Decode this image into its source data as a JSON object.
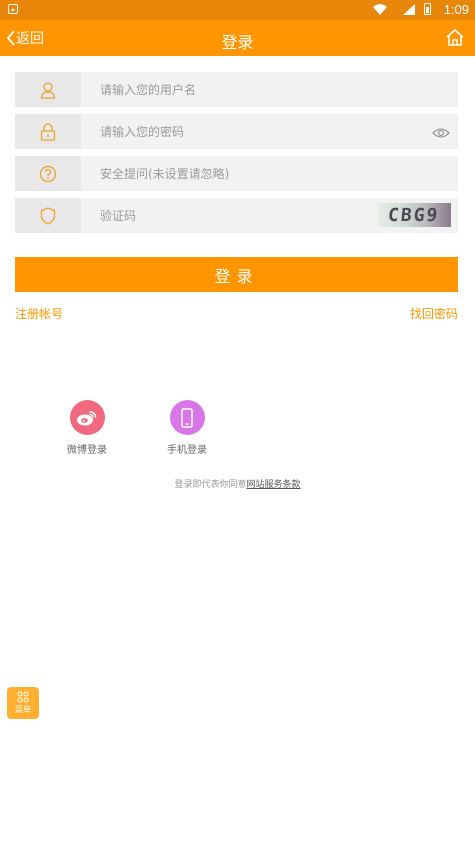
{
  "status_bar": {
    "time": "1:09"
  },
  "nav": {
    "back_label": "返回",
    "title": "登录"
  },
  "form": {
    "username_placeholder": "请输入您的用户名",
    "password_placeholder": "请输入您的密码",
    "security_question_placeholder": "安全提问(未设置请忽略)",
    "captcha_placeholder": "验证码",
    "captcha_text": "CBG9",
    "submit_label": "登录"
  },
  "links": {
    "register": "注册帐号",
    "forgot_password": "找回密码"
  },
  "social": [
    {
      "label": "微博登录",
      "icon": "weibo-icon",
      "color": "#f2687e"
    },
    {
      "label": "手机登录",
      "icon": "phone-icon",
      "color": "#d876e8"
    }
  ],
  "terms": {
    "prefix": "登录即代表你同意",
    "link": "网站服务条款"
  },
  "floating_menu": {
    "label": "菜单"
  },
  "colors": {
    "accent": "#ff9500",
    "status_bar": "#e8860a"
  }
}
